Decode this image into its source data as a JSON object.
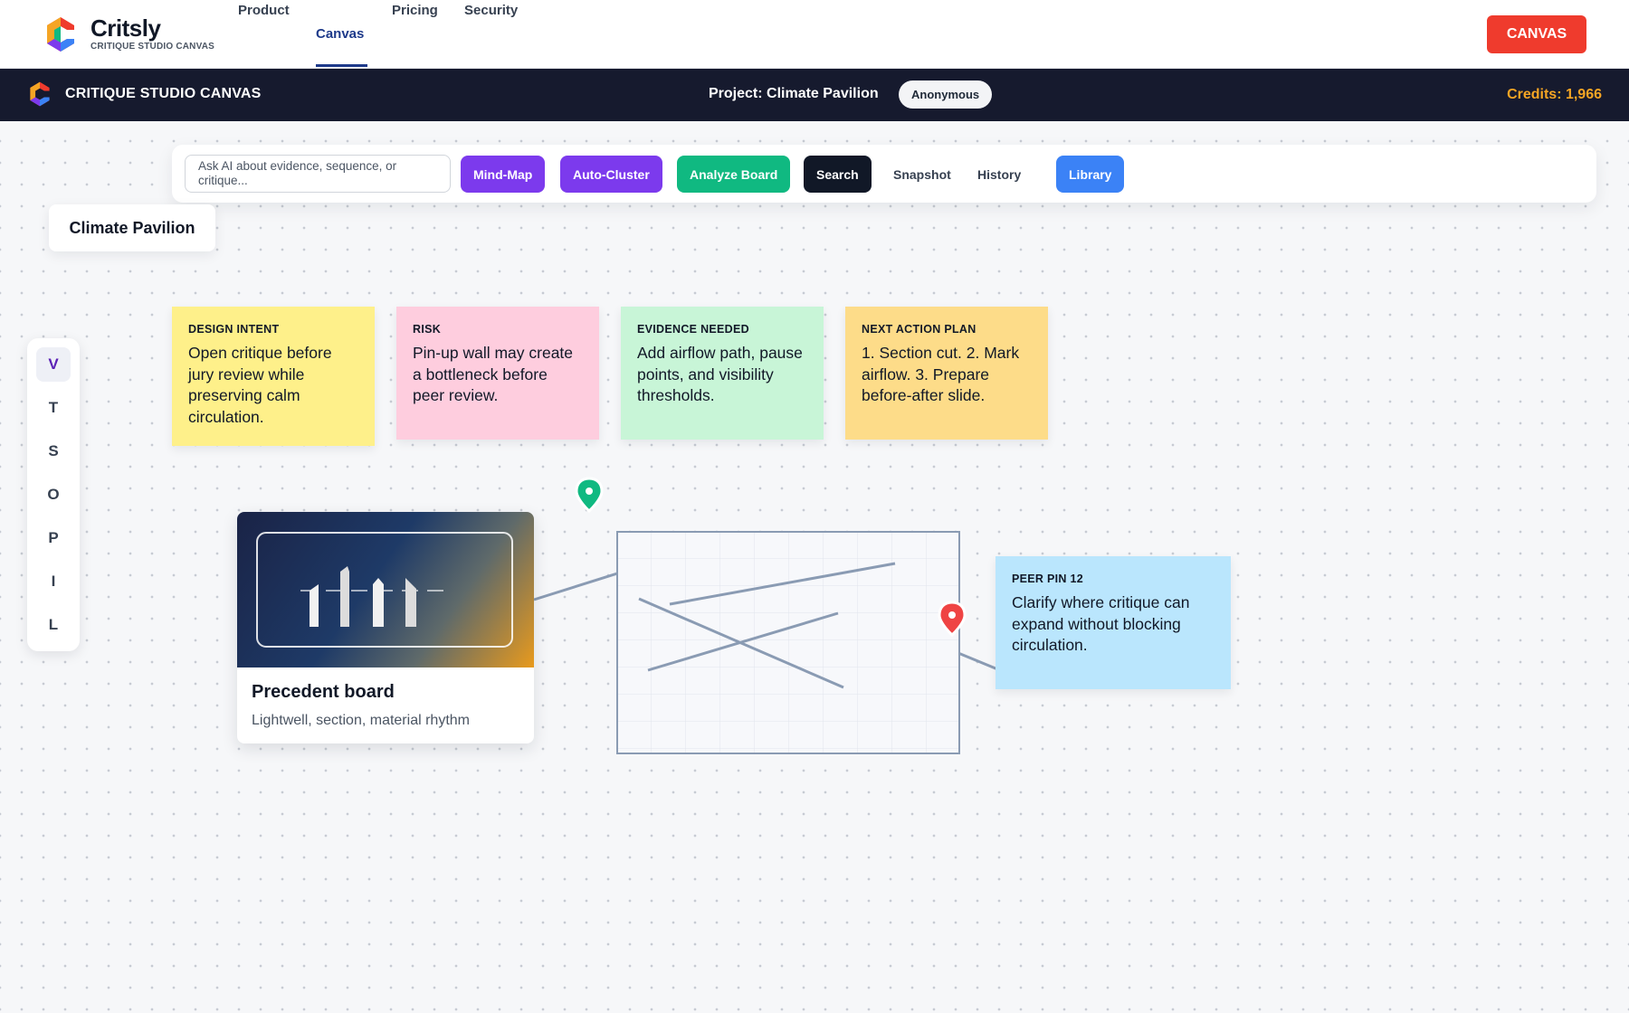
{
  "brand": {
    "name": "Critsly",
    "subtitle": "CRITIQUE STUDIO CANVAS"
  },
  "nav": {
    "links": [
      {
        "label": "Product",
        "active": false
      },
      {
        "label": "Canvas",
        "active": true
      },
      {
        "label": "Pricing",
        "active": false
      },
      {
        "label": "Security",
        "active": false
      }
    ],
    "cta": "CANVAS"
  },
  "appbar": {
    "title": "CRITIQUE STUDIO CANVAS",
    "project": "Project: Climate Pavilion",
    "user": "Anonymous",
    "credits": "Credits: 1,966"
  },
  "toolbar": {
    "ask_placeholder": "Ask AI about evidence, sequence, or critique...",
    "buttons": [
      {
        "label": "Mind-Map",
        "color": "#7c3aed"
      },
      {
        "label": "Auto-Cluster",
        "color": "#7c3aed"
      },
      {
        "label": "Analyze Board",
        "color": "#10b981"
      },
      {
        "label": "Search",
        "color": "#111827"
      },
      {
        "label": "Snapshot",
        "color": ""
      },
      {
        "label": "History",
        "color": ""
      },
      {
        "label": "Library",
        "color": "#3b82f6"
      }
    ]
  },
  "project_tag": "Climate Pavilion",
  "tools": [
    "V",
    "T",
    "S",
    "O",
    "P",
    "I",
    "L"
  ],
  "active_tool": "V",
  "notes": [
    {
      "label": "DESIGN INTENT",
      "text": "Open critique before jury review while preserving calm circulation.",
      "color": "#fef08a"
    },
    {
      "label": "RISK",
      "text": "Pin-up wall may create a bottleneck before peer review.",
      "color": "#fecdde"
    },
    {
      "label": "EVIDENCE NEEDED",
      "text": "Add airflow path, pause points, and visibility thresholds.",
      "color": "#c8f5d7"
    },
    {
      "label": "NEXT ACTION PLAN",
      "text": "1. Section cut. 2. Mark airflow. 3. Prepare before-after slide.",
      "color": "#fddc89"
    }
  ],
  "peer_pin": {
    "label": "PEER PIN 12",
    "text": "Clarify where critique can expand without blocking circulation.",
    "color": "#bae6fd"
  },
  "precedent": {
    "title": "Precedent board",
    "subtitle": "Lightwell, section, material rhythm"
  },
  "pins": [
    {
      "name": "pin-green",
      "color": "#10b981"
    },
    {
      "name": "pin-red",
      "color": "#ef4444"
    }
  ]
}
